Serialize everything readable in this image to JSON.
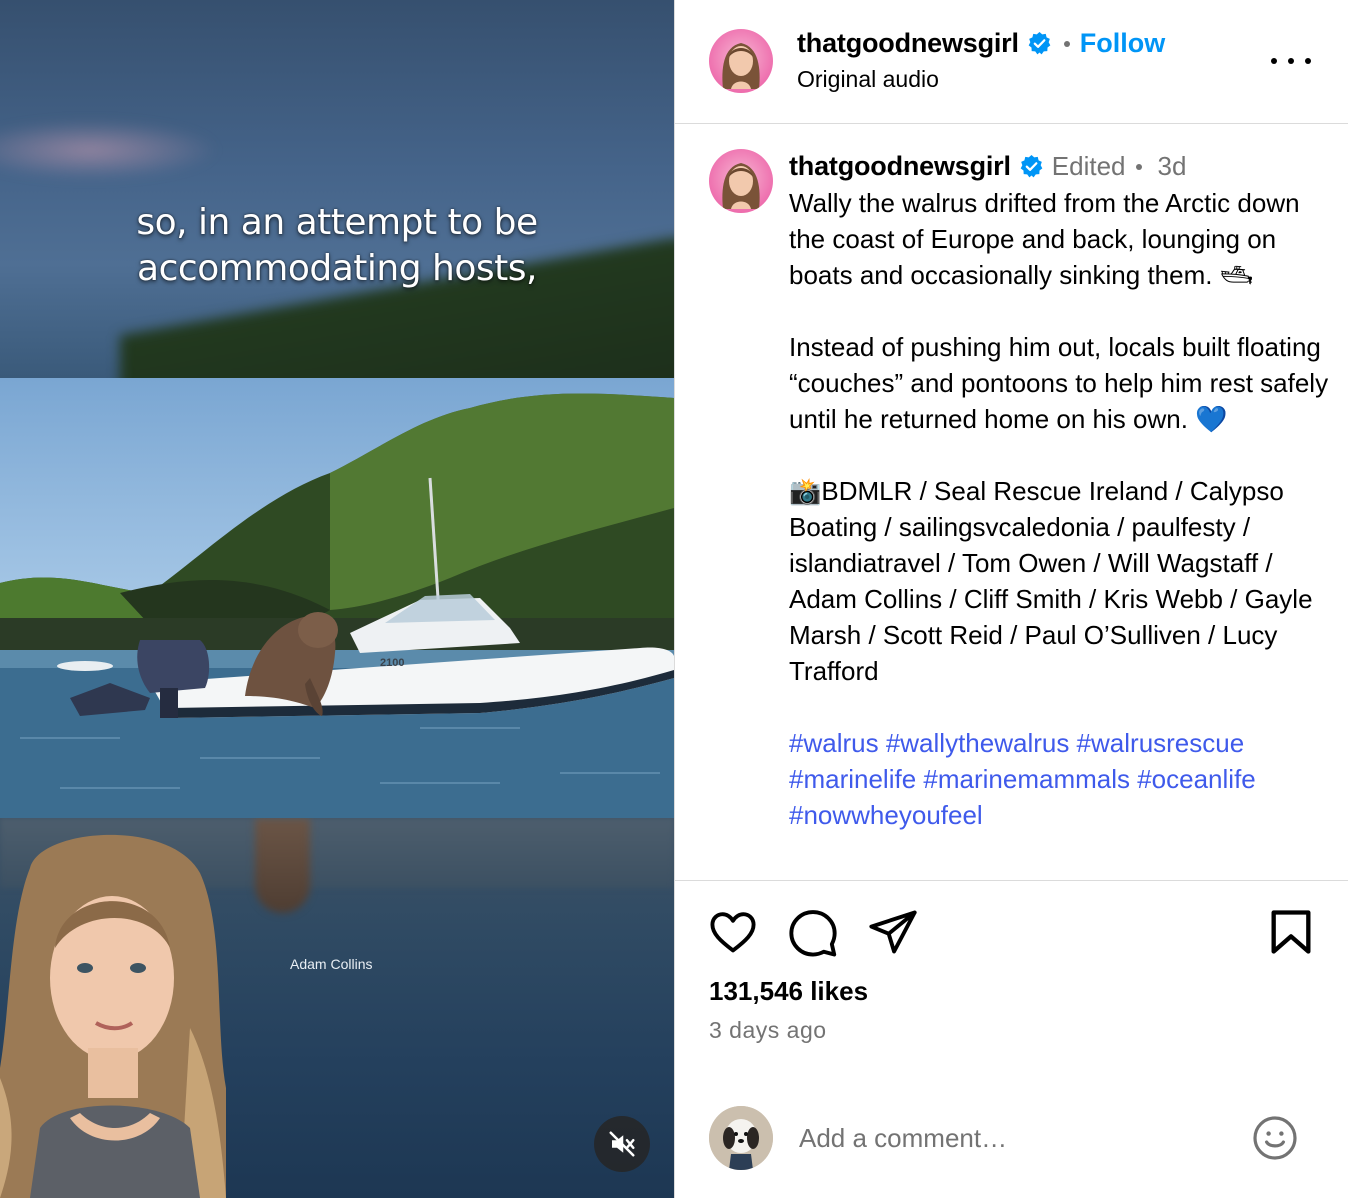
{
  "media": {
    "caption_text": "so, in an attempt to be\naccommodating hosts,",
    "photo_credit": "Adam Collins",
    "boat_label": "2100"
  },
  "post": {
    "username": "thatgoodnewsgirl",
    "follow_label": "Follow",
    "audio_label": "Original audio",
    "edited_label": "Edited",
    "age": "3d",
    "caption_paragraphs": [
      "Wally the walrus drifted from the Arctic down the coast of Europe and back, lounging on boats and occasionally sinking them. 🛥",
      "Instead of pushing him out, locals built floating “couches” and pontoons to help him rest safely until he returned home on his own. 💙",
      "📸BDMLR / Seal Rescue Ireland / Calypso Boating / sailingsvcaledonia / paulfesty / islandiatravel / Tom Owen / Will Wagstaff / Adam Collins / Cliff Smith / Kris Webb / Gayle Marsh / Scott Reid / Paul O’Sulliven / Lucy Trafford"
    ],
    "hashtags": "#walrus #wallythewalrus #walrusrescue #marinelife #marinemammals #oceanlife #nowwheyoufeel",
    "likes": "131,546 likes",
    "posted_ago": "3 days ago"
  },
  "comment": {
    "placeholder": "Add a comment…"
  },
  "icons": {
    "verified": "verified-badge-icon",
    "more": "more-options-icon",
    "like": "heart-icon",
    "comment": "comment-bubble-icon",
    "share": "send-paper-plane-icon",
    "save": "bookmark-icon",
    "mute": "speaker-muted-icon",
    "emoji": "smiley-icon"
  },
  "colors": {
    "accent": "#0095f6",
    "hashtag": "#3f5aeb",
    "verified": "#0095f6",
    "muted_text": "#737373"
  }
}
